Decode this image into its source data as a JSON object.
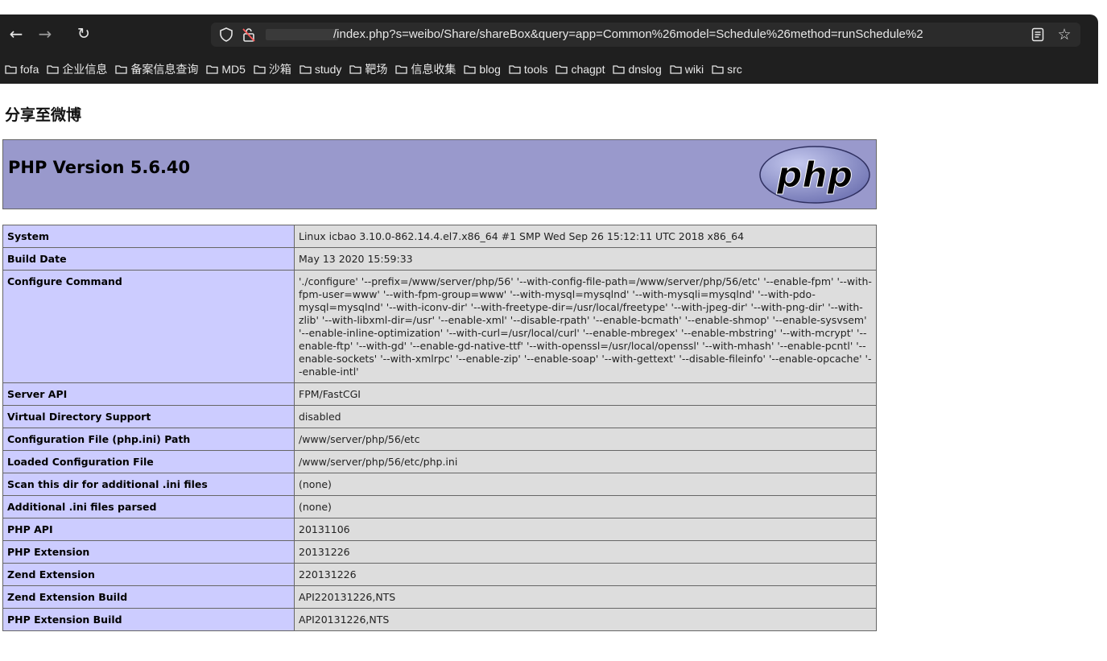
{
  "browser": {
    "url": "/index.php?s=weibo/Share/shareBox&query=app=Common%26model=Schedule%26method=runSchedule%2",
    "bookmarks": [
      "fofa",
      "企业信息",
      "备案信息查询",
      "MD5",
      "沙箱",
      "study",
      "靶场",
      "信息收集",
      "blog",
      "tools",
      "chagpt",
      "dnslog",
      "wiki",
      "src"
    ]
  },
  "page": {
    "title": "分享至微博",
    "php_version": "PHP Version 5.6.40",
    "logo_text": "php"
  },
  "rows": [
    {
      "label": "System",
      "value": "Linux icbao 3.10.0-862.14.4.el7.x86_64 #1 SMP Wed Sep 26 15:12:11 UTC 2018 x86_64"
    },
    {
      "label": "Build Date",
      "value": "May 13 2020 15:59:33"
    },
    {
      "label": "Configure Command",
      "value": "'./configure' '--prefix=/www/server/php/56' '--with-config-file-path=/www/server/php/56/etc' '--enable-fpm' '--with-fpm-user=www' '--with-fpm-group=www' '--with-mysql=mysqlnd' '--with-mysqli=mysqlnd' '--with-pdo-mysql=mysqlnd' '--with-iconv-dir' '--with-freetype-dir=/usr/local/freetype' '--with-jpeg-dir' '--with-png-dir' '--with-zlib' '--with-libxml-dir=/usr' '--enable-xml' '--disable-rpath' '--enable-bcmath' '--enable-shmop' '--enable-sysvsem' '--enable-inline-optimization' '--with-curl=/usr/local/curl' '--enable-mbregex' '--enable-mbstring' '--with-mcrypt' '--enable-ftp' '--with-gd' '--enable-gd-native-ttf' '--with-openssl=/usr/local/openssl' '--with-mhash' '--enable-pcntl' '--enable-sockets' '--with-xmlrpc' '--enable-zip' '--enable-soap' '--with-gettext' '--disable-fileinfo' '--enable-opcache' '--enable-intl'"
    },
    {
      "label": "Server API",
      "value": "FPM/FastCGI"
    },
    {
      "label": "Virtual Directory Support",
      "value": "disabled"
    },
    {
      "label": "Configuration File (php.ini) Path",
      "value": "/www/server/php/56/etc"
    },
    {
      "label": "Loaded Configuration File",
      "value": "/www/server/php/56/etc/php.ini"
    },
    {
      "label": "Scan this dir for additional .ini files",
      "value": "(none)"
    },
    {
      "label": "Additional .ini files parsed",
      "value": "(none)"
    },
    {
      "label": "PHP API",
      "value": "20131106"
    },
    {
      "label": "PHP Extension",
      "value": "20131226"
    },
    {
      "label": "Zend Extension",
      "value": "220131226"
    },
    {
      "label": "Zend Extension Build",
      "value": "API220131226,NTS"
    },
    {
      "label": "PHP Extension Build",
      "value": "API20131226,NTS"
    }
  ],
  "colors": {
    "header_bg": "#9999cc",
    "label_bg": "#ccccff",
    "value_bg": "#dddddd",
    "chrome_bg": "#1f1f1f"
  }
}
